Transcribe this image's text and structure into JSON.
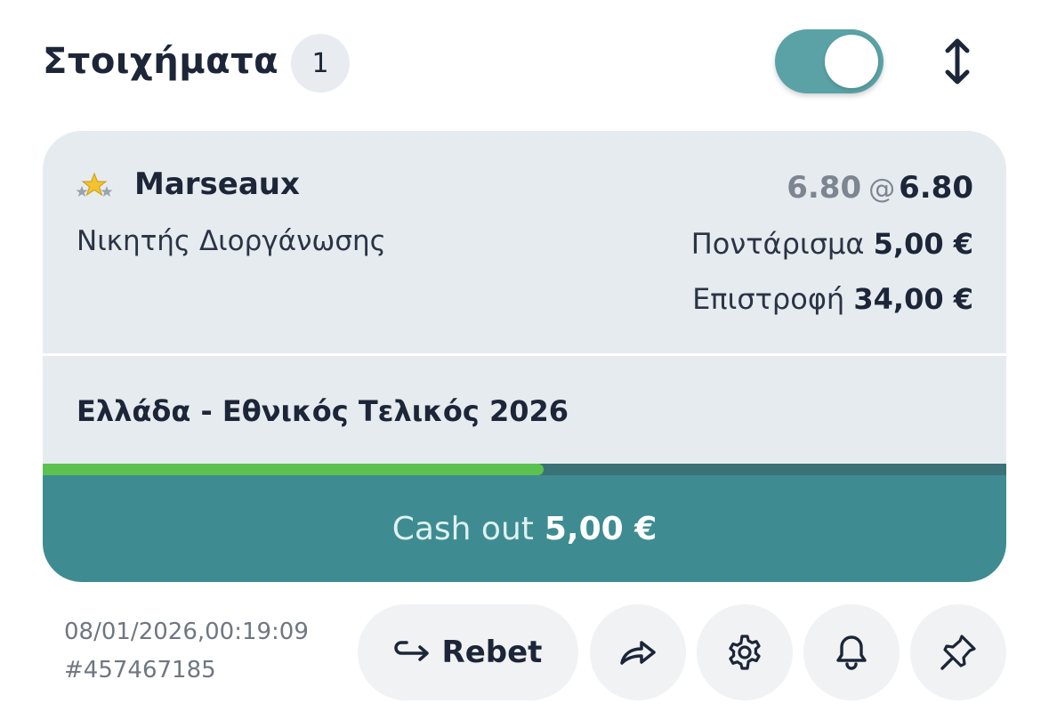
{
  "header": {
    "title": "Στοιχήματα",
    "count": "1",
    "toggle_on": true
  },
  "bet": {
    "selection": "Marseaux",
    "market": "Νικητής Διοργάνωσης",
    "odds_original": "6.80",
    "odds_separator": "@",
    "odds_current": "6.80",
    "stake_label": "Ποντάρισμα",
    "stake_value": "5,00 €",
    "return_label": "Επιστροφή",
    "return_value": "34,00 €",
    "event": "Ελλάδα - Εθνικός Τελικός 2026",
    "progress_fraction": 0.52,
    "cashout_label": "Cash out",
    "cashout_value": "5,00 €"
  },
  "footer": {
    "timestamp": "08/01/2026,00:19:09",
    "bet_id": "#457467185",
    "rebet_label": "Rebet"
  },
  "colors": {
    "accent": "#3e8c91",
    "toggle": "#5aa2a6",
    "progress_fill": "#5cc14f",
    "card_bg": "#e6ebef"
  },
  "icons": [
    "expand-vertical-icon",
    "stars-icon",
    "rebet-arrow-icon",
    "share-icon",
    "gear-icon",
    "bell-icon",
    "pin-icon"
  ]
}
